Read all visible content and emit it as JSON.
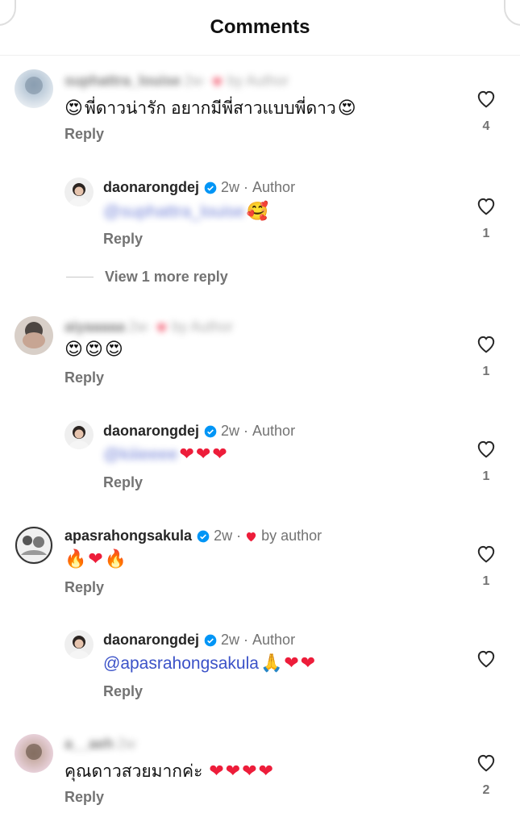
{
  "header": {
    "title": "Comments"
  },
  "comments": [
    {
      "id": "c1",
      "username": "suphattra_louise",
      "time": "2w",
      "by_author": "by Author",
      "text": "พี่ดาวน่ารัก อยากมีพี่สาวแบบพี่ดาว",
      "reply_label": "Reply",
      "likes": "4"
    },
    {
      "id": "r1",
      "username": "daonarongdej",
      "time": "2w",
      "author_tag": "Author",
      "mention": "@suphattra_louise",
      "reply_label": "Reply",
      "likes": "1"
    },
    {
      "id": "c2",
      "username": "aiyaaaaa",
      "time": "2w",
      "by_author": "by Author",
      "reply_label": "Reply",
      "likes": "1"
    },
    {
      "id": "r2",
      "username": "daonarongdej",
      "time": "2w",
      "author_tag": "Author",
      "mention": "@kiiieeee",
      "reply_label": "Reply",
      "likes": "1"
    },
    {
      "id": "c3",
      "username": "apasrahongsakula",
      "time": "2w",
      "by_author": "by author",
      "reply_label": "Reply",
      "likes": "1"
    },
    {
      "id": "r3",
      "username": "daonarongdej",
      "time": "2w",
      "author_tag": "Author",
      "mention": "@apasrahongsakula",
      "reply_label": "Reply",
      "likes": ""
    },
    {
      "id": "c4",
      "username": "a__aeh",
      "time": "2w",
      "text": "คุณดาวสวยมากค่ะ",
      "reply_label": "Reply",
      "likes": "2"
    }
  ],
  "view_more": {
    "label": "View 1 more reply"
  },
  "colors": {
    "heart_red": "#ed1d3a",
    "verified_blue": "#0095f6",
    "mention_blue": "#3b52c8"
  }
}
